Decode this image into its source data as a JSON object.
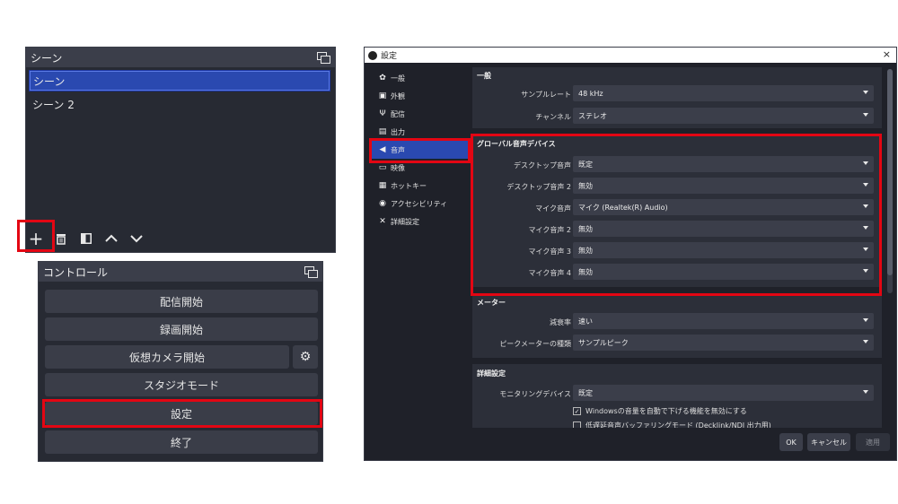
{
  "scenes_panel": {
    "title": "シーン",
    "scenes": [
      {
        "label": "シーン",
        "selected": true
      },
      {
        "label": "シーン 2",
        "selected": false
      }
    ],
    "toolbar": {
      "add": "+",
      "remove_icon": "trash-icon",
      "filter_icon": "filter-icon",
      "up": "∧",
      "down": "∨"
    }
  },
  "controls_panel": {
    "title": "コントロール",
    "buttons": {
      "start_streaming": "配信開始",
      "start_recording": "録画開始",
      "start_virtual_camera": "仮想カメラ開始",
      "studio_mode": "スタジオモード",
      "settings": "設定",
      "exit": "終了"
    }
  },
  "settings_window": {
    "title": "設定",
    "close": "×",
    "nav": [
      {
        "icon": "gear-icon",
        "glyph": "✿",
        "label": "一般"
      },
      {
        "icon": "appearance-icon",
        "glyph": "▣",
        "label": "外観"
      },
      {
        "icon": "stream-icon",
        "glyph": "Ψ",
        "label": "配信"
      },
      {
        "icon": "output-icon",
        "glyph": "▤",
        "label": "出力"
      },
      {
        "icon": "speaker-icon",
        "glyph": "◀",
        "label": "音声"
      },
      {
        "icon": "monitor-icon",
        "glyph": "▭",
        "label": "映像"
      },
      {
        "icon": "keyboard-icon",
        "glyph": "▦",
        "label": "ホットキー"
      },
      {
        "icon": "accessibility-icon",
        "glyph": "◉",
        "label": "アクセシビリティ"
      },
      {
        "icon": "tools-icon",
        "glyph": "✕",
        "label": "詳細設定"
      }
    ],
    "general": {
      "title": "一般",
      "sample_rate_label": "サンプルレート",
      "sample_rate_value": "48 kHz",
      "channels_label": "チャンネル",
      "channels_value": "ステレオ"
    },
    "global_audio": {
      "title": "グローバル音声デバイス",
      "rows": [
        {
          "label": "デスクトップ音声",
          "value": "既定"
        },
        {
          "label": "デスクトップ音声 2",
          "value": "無効"
        },
        {
          "label": "マイク音声",
          "value": "マイク (Realtek(R) Audio)"
        },
        {
          "label": "マイク音声 2",
          "value": "無効"
        },
        {
          "label": "マイク音声 3",
          "value": "無効"
        },
        {
          "label": "マイク音声 4",
          "value": "無効"
        }
      ]
    },
    "meters": {
      "title": "メーター",
      "decay_label": "減衰率",
      "decay_value": "速い",
      "peak_meter_label": "ピークメーターの種類",
      "peak_meter_value": "サンプルピーク"
    },
    "advanced": {
      "title": "詳細設定",
      "monitoring_label": "モニタリングデバイス",
      "monitoring_value": "既定",
      "ducking_label": "Windowsの音量を自動で下げる機能を無効にする",
      "ducking_checked": true,
      "low_latency_label": "低遅延音声バッファリングモード (Decklink/NDI 出力用)",
      "low_latency_checked": false
    },
    "footer": {
      "ok": "OK",
      "cancel": "キャンセル",
      "apply": "適用"
    }
  }
}
